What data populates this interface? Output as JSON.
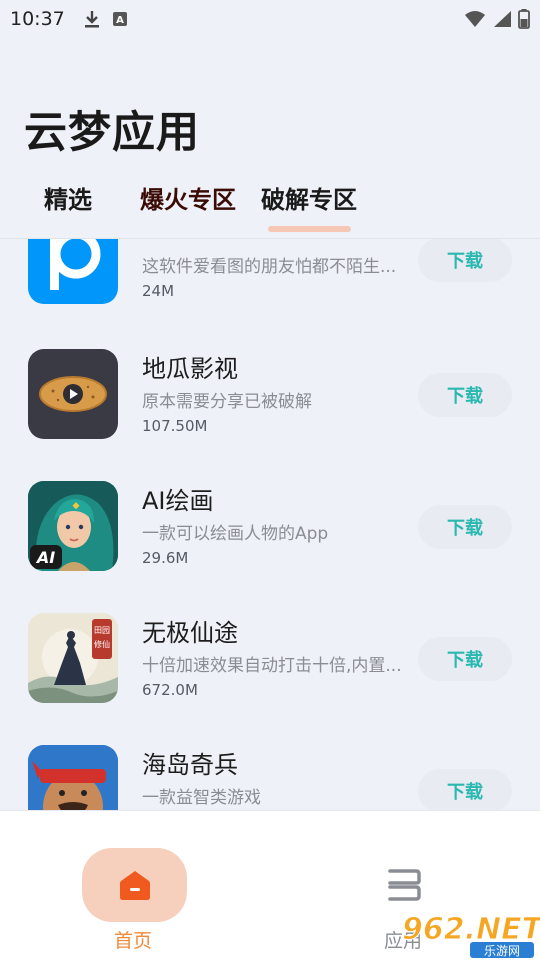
{
  "status_bar": {
    "time": "10:37",
    "icons": [
      "download-icon",
      "a-box-icon",
      "wifi-icon",
      "signal-icon",
      "battery-icon"
    ]
  },
  "header": {
    "title": "云梦应用",
    "tabs": [
      {
        "label": "精选"
      },
      {
        "label": "爆火专区"
      },
      {
        "label": "破解专区",
        "selected": true
      }
    ]
  },
  "apps": [
    {
      "name": "pixiv",
      "desc": "这软件爱看图的朋友怕都不陌生...",
      "size": "24M",
      "button": "下载",
      "icon": "pixiv-icon"
    },
    {
      "name": "地瓜影视",
      "desc": "原本需要分享已被破解",
      "size": "107.50M",
      "button": "下载",
      "icon": "sweet-potato-play-icon"
    },
    {
      "name": "AI绘画",
      "desc": "一款可以绘画人物的App",
      "size": "29.6M",
      "button": "下载",
      "icon": "ai-painting-icon"
    },
    {
      "name": "无极仙途",
      "desc": "十倍加速效果自动打击十倍,内置...",
      "size": "672.0M",
      "button": "下载",
      "icon": "wuji-xiantu-icon"
    },
    {
      "name": "海岛奇兵",
      "desc": "一款益智类游戏",
      "size": "",
      "button": "下载",
      "icon": "boom-beach-icon"
    }
  ],
  "bottom_nav": {
    "home_label": "首页",
    "apps_label": "应用"
  },
  "colors": {
    "accent": "#f08a3a",
    "download_text": "#2ab8b0",
    "tab_indicator": "#f5c7b4"
  },
  "watermark": {
    "text": "962.NET",
    "subtext": "乐游网"
  }
}
